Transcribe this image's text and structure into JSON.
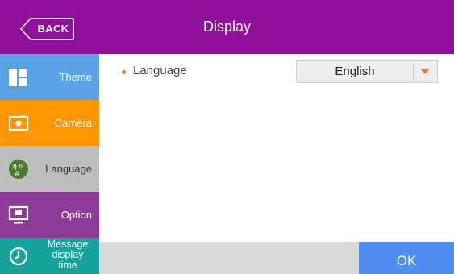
{
  "header": {
    "title": "Display",
    "back_label": "BACK"
  },
  "sidebar": {
    "items": [
      {
        "label": "Theme",
        "icon": "theme-icon",
        "color": "#5aa3e6"
      },
      {
        "label": "Camera",
        "icon": "camera-icon",
        "color": "#ff9500"
      },
      {
        "label": "Language",
        "icon": "language-icon",
        "color": "#bdbdbd",
        "selected": true
      },
      {
        "label": "Option",
        "icon": "monitor-icon",
        "color": "#8e3a98"
      },
      {
        "label": "Message\ndisplay\ntime",
        "icon": "clock-icon",
        "color": "#16a39a"
      }
    ]
  },
  "main": {
    "language_label": "Language",
    "language_value": "English"
  },
  "footer": {
    "ok_label": "OK"
  },
  "colors": {
    "header": "#8e109b",
    "accent_bullet": "#e8743b",
    "ok_button": "#4d8ef0"
  }
}
